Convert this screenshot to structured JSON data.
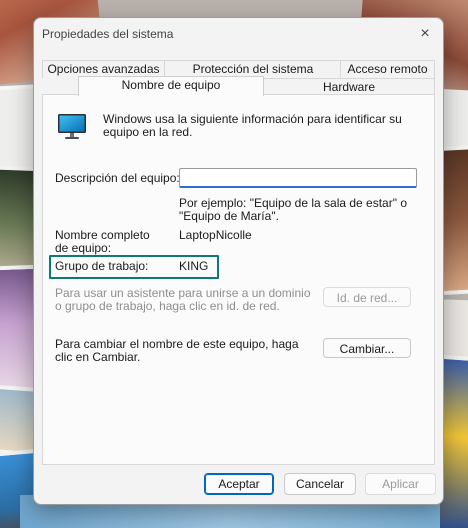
{
  "window": {
    "title": "Propiedades del sistema",
    "close_icon": "×"
  },
  "tabs": [
    {
      "label": "Opciones avanzadas",
      "selected": false
    },
    {
      "label": "Protección del sistema",
      "selected": false
    },
    {
      "label": "Acceso remoto",
      "selected": false
    },
    {
      "label": "Nombre de equipo",
      "selected": true
    },
    {
      "label": "Hardware",
      "selected": false
    }
  ],
  "computer_name_tab": {
    "icon": "monitor-icon",
    "intro": "Windows usa la siguiente información para identificar su equipo en la red.",
    "description_label": "Descripción del equipo:",
    "description_value": "",
    "description_example": "Por ejemplo: \"Equipo de la sala de estar\" o \"Equipo de María\".",
    "full_name_label": "Nombre completo de equipo:",
    "full_name_value": "LaptopNicolle",
    "workgroup_label": "Grupo de trabajo:",
    "workgroup_value": "KING",
    "workgroup_highlight_color": "#0e7a72",
    "domain_text": "Para usar un asistente para unirse a un dominio o grupo de trabajo, haga clic en id. de red.",
    "network_id_button": "Id. de red...",
    "change_text": "Para cambiar el nombre de este equipo, haga clic en Cambiar.",
    "change_button": "Cambiar..."
  },
  "footer": {
    "ok": "Aceptar",
    "cancel": "Cancelar",
    "apply": "Aplicar"
  },
  "colors": {
    "accent": "#0067c0",
    "input_focus": "#2f6ccf"
  }
}
